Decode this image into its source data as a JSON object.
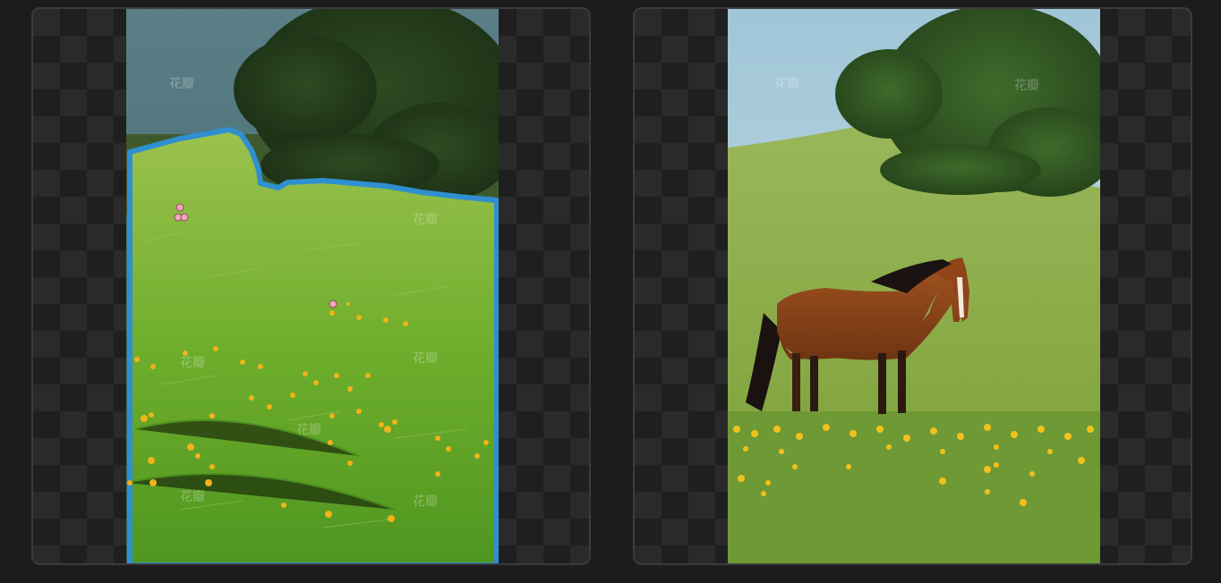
{
  "panels": [
    {
      "id": "mask-editor",
      "role": "inpaint mask preview",
      "mask_color": "#2f8fd0",
      "brush_points_color": "#f2a7b8"
    },
    {
      "id": "result",
      "role": "generated result preview"
    }
  ],
  "watermark": "花瓣",
  "colors": {
    "background": "#1c1c1c",
    "panel_border": "#3b3b3b",
    "checker_dark": "#1f1f1f",
    "checker_light": "#2a2a2a",
    "mask_outline": "#2f8fd0"
  }
}
